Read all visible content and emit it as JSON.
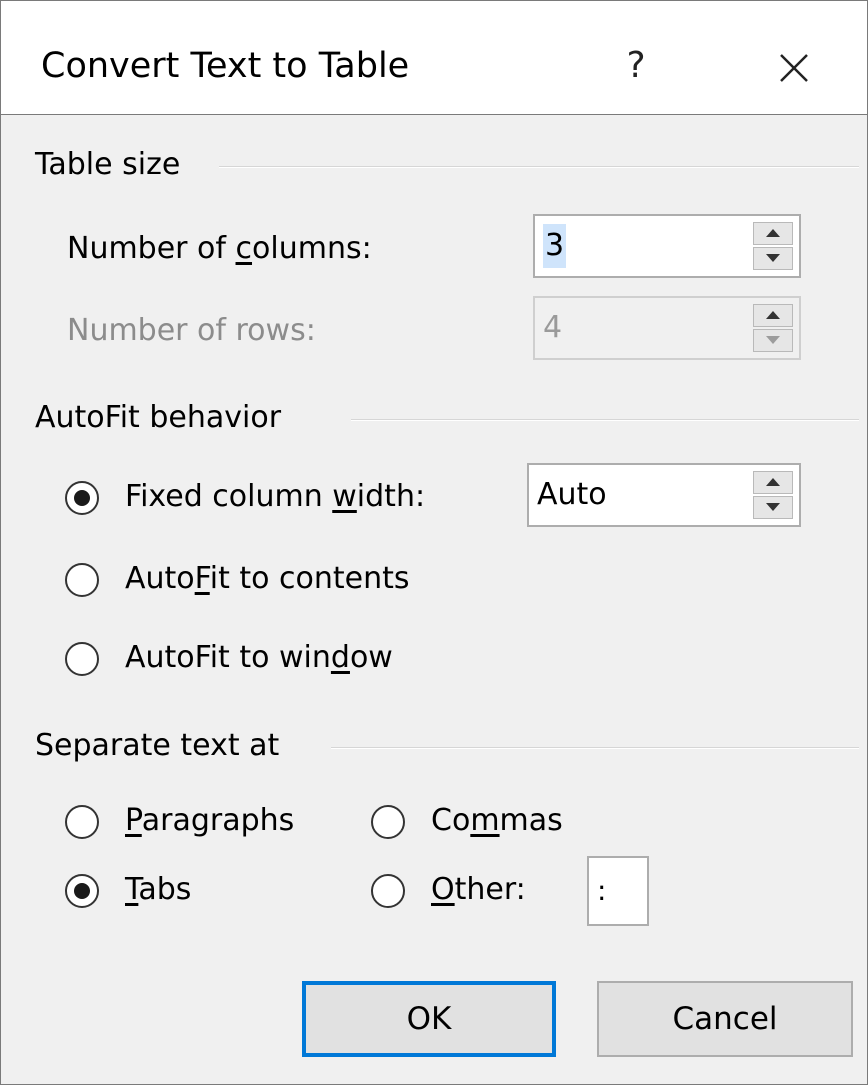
{
  "dialog": {
    "title": "Convert Text to Table",
    "help_label": "?",
    "close_icon": "close-icon"
  },
  "table_size": {
    "heading": "Table size",
    "columns_label_pre": "Number of ",
    "columns_label_ul": "c",
    "columns_label_post": "olumns:",
    "columns_value": "3",
    "rows_label": "Number of rows:",
    "rows_value": "4"
  },
  "autofit": {
    "heading": "AutoFit behavior",
    "fixed_pre": "Fixed column ",
    "fixed_ul": "w",
    "fixed_post": "idth:",
    "fixed_value": "Auto",
    "contents_pre": "Auto",
    "contents_ul": "F",
    "contents_post": "it to contents",
    "window_pre": "AutoFit to win",
    "window_ul": "d",
    "window_post": "ow",
    "selected": "fixed"
  },
  "separate": {
    "heading": "Separate text at",
    "paragraphs_ul": "P",
    "paragraphs_post": "aragraphs",
    "commas_pre": "Co",
    "commas_ul": "m",
    "commas_post": "mas",
    "tabs_ul": "T",
    "tabs_post": "abs",
    "other_ul": "O",
    "other_post": "ther:",
    "other_value": ":",
    "selected": "tabs"
  },
  "buttons": {
    "ok_label": "OK",
    "cancel_label": "Cancel"
  }
}
